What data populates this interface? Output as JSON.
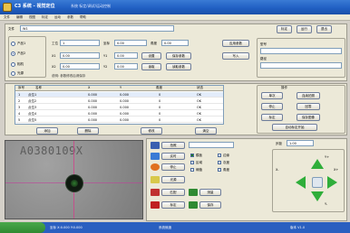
{
  "window": {
    "title": "C3 系统 - 视觉定位",
    "subtitle": "系统  标定/调试/运动控制"
  },
  "menu": [
    "文件",
    "编辑",
    "视图",
    "标定",
    "运动",
    "参数",
    "帮助"
  ],
  "tabs": [
    "标定",
    "运行",
    "退出"
  ],
  "top_form": {
    "name_label": "文件",
    "name_value": "W1",
    "radios": [
      "产品1",
      "产品2",
      "相机",
      "光源"
    ],
    "selected_radio": 1,
    "row1": {
      "label_a": "工位",
      "value_a": "1",
      "label_b": "坐标",
      "value_b": "0.00",
      "label_c": "角度",
      "value_c": "0.00"
    },
    "row2": {
      "label_a": "X1",
      "value_a": "0.00",
      "label_b": "Y1",
      "value_b": "0.00",
      "label_c": "偏移",
      "value_c": "0.00"
    },
    "row3": {
      "label_a": "X2",
      "value_a": "0.00",
      "label_b": "Y2",
      "value_b": "0.00",
      "label_c": "偏移",
      "value_c": "0.00"
    },
    "btn_col1": [
      "设置",
      "读取",
      "写入"
    ],
    "btn_col2": [
      "保存参数",
      "读取参数",
      "应用参数"
    ],
    "note": "说明: 参数修改后请保存"
  },
  "right_form": {
    "label": "型号",
    "value": "",
    "label2": "路径",
    "value2": ""
  },
  "grid": {
    "headers": [
      "序号",
      "名称",
      "X",
      "Y",
      "角度",
      "状态"
    ],
    "rows": [
      [
        "1",
        "点位1",
        "0.000",
        "0.000",
        "0",
        "OK"
      ],
      [
        "2",
        "点位2",
        "0.000",
        "0.000",
        "0",
        "OK"
      ],
      [
        "3",
        "点位3",
        "0.000",
        "0.000",
        "0",
        "OK"
      ],
      [
        "4",
        "点位4",
        "0.000",
        "0.000",
        "0",
        "OK"
      ],
      [
        "5",
        "点位5",
        "0.000",
        "0.000",
        "0",
        "OK"
      ]
    ],
    "buttons": [
      "添加",
      "删除",
      "修改",
      "清空"
    ]
  },
  "right_panel": {
    "title": "操作",
    "buttons": [
      "单次",
      "连续拍照",
      "停止",
      "回零",
      "标定",
      "保存图像",
      "自动标定开始"
    ]
  },
  "camera": {
    "watermark": "A0380109X"
  },
  "control": {
    "buttons": [
      "拍照",
      "实时",
      "停止",
      "光源",
      "匹配",
      "标定",
      "测量",
      "保存"
    ],
    "options": [
      "模板",
      "区域",
      "阈值",
      "边缘",
      "灰度",
      "角度"
    ],
    "jog_labels": [
      "X+",
      "X-",
      "Y+",
      "Y-"
    ],
    "jog_step_label": "步距",
    "jog_step_value": "1.00"
  },
  "status": {
    "left": "坐标 X:0.000 Y:0.000",
    "mid": "系统就绪",
    "right": "版本 V1.0"
  },
  "colors": {
    "title_bar": "#2160c4",
    "accent_green": "#2f8a32",
    "crosshair": "#d43c8a"
  }
}
